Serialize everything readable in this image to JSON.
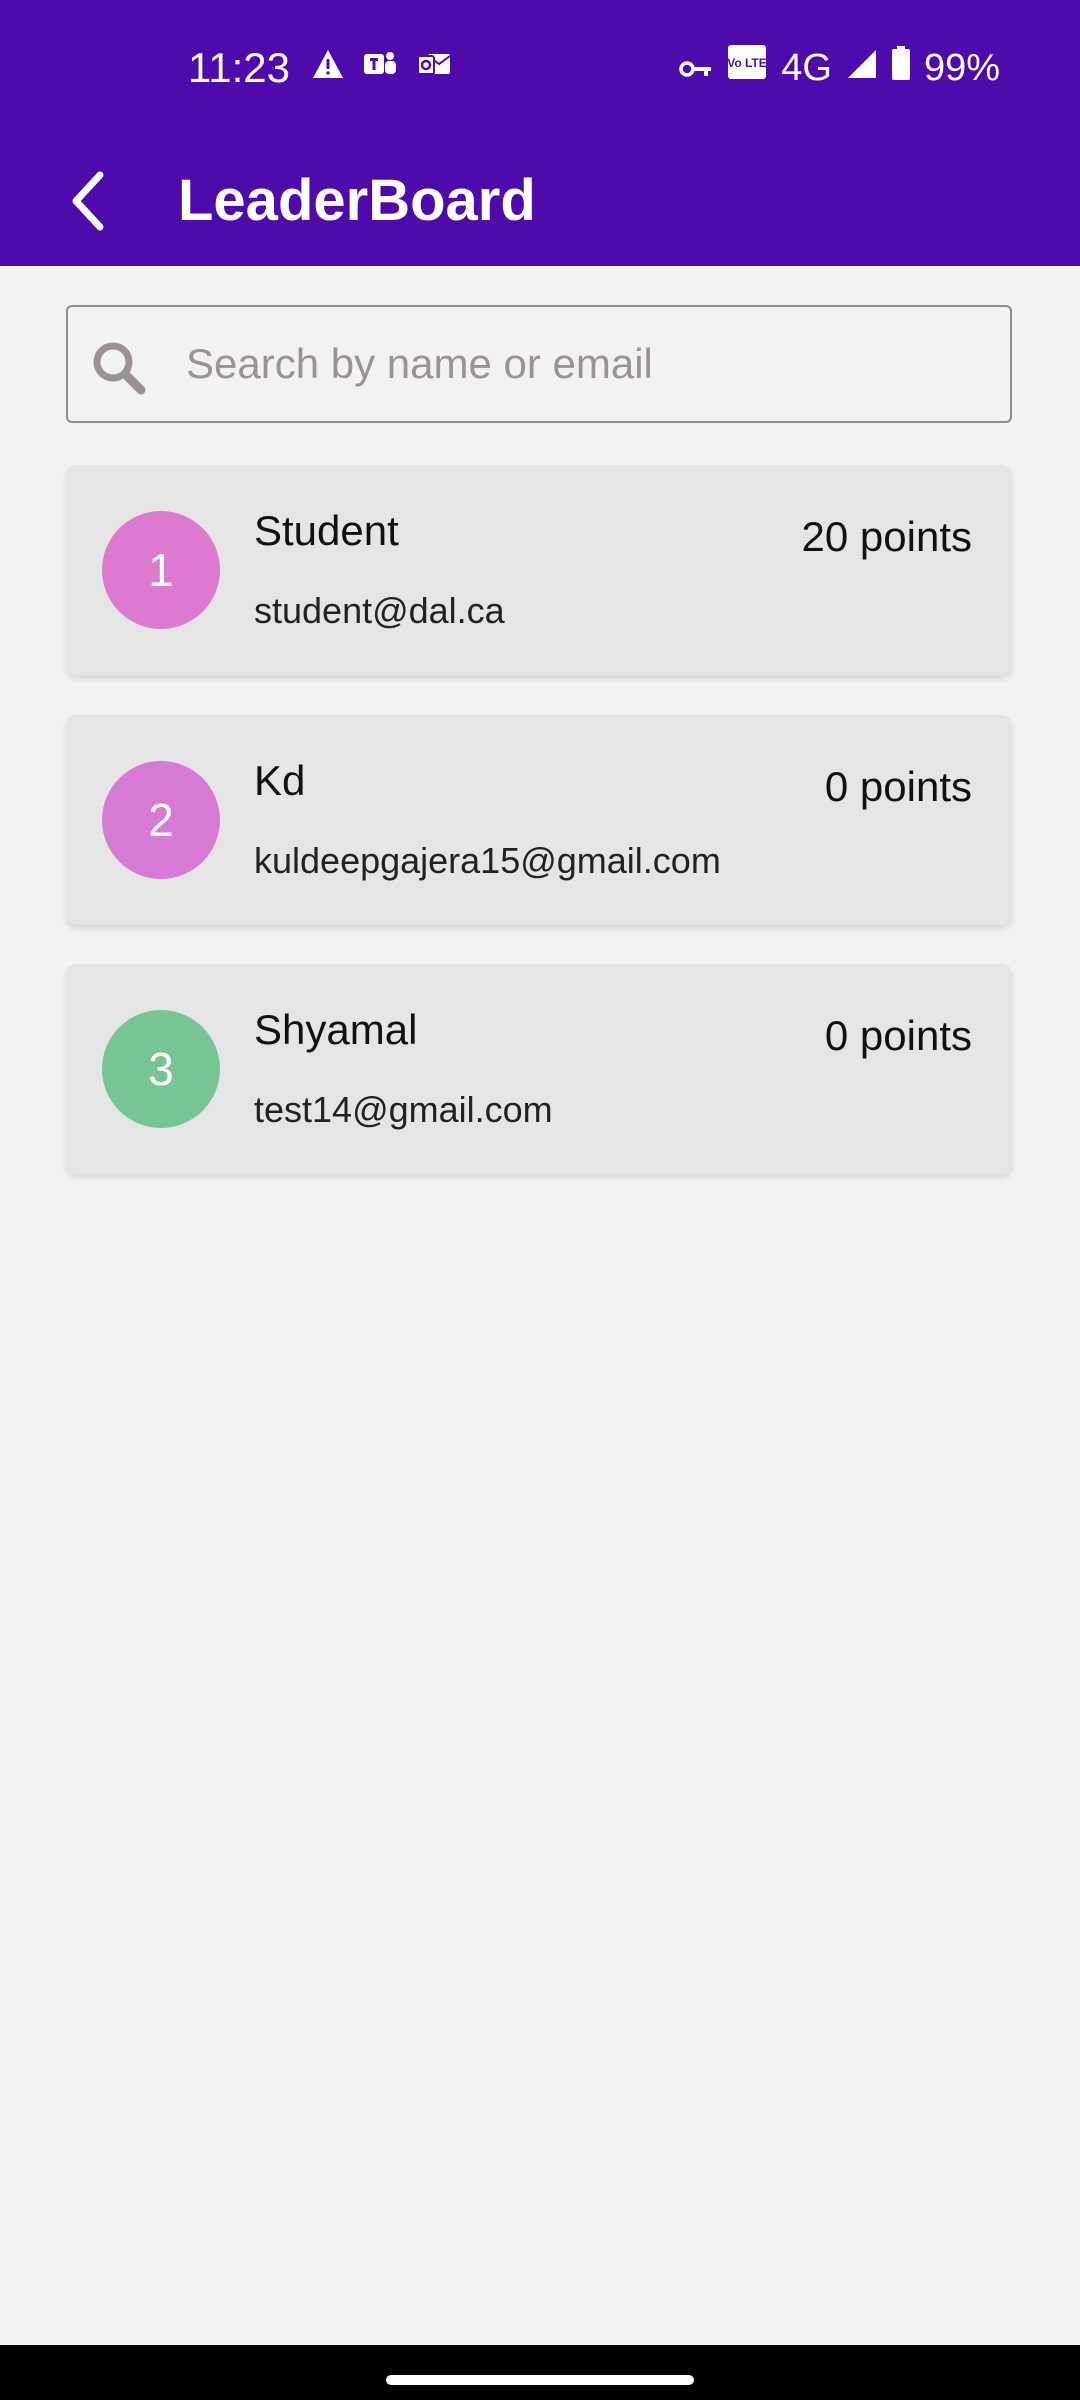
{
  "status_bar": {
    "time": "11:23",
    "network": "4G",
    "battery": "99%",
    "volte_label": "Vo LTE",
    "icons": [
      "alert-icon",
      "teams-icon",
      "outlook-icon",
      "vpn-key-icon",
      "volte-icon",
      "signal-icon",
      "battery-icon"
    ]
  },
  "app_bar": {
    "title": "LeaderBoard",
    "back_icon": "back-arrow-icon",
    "background_color": "#4f0aab"
  },
  "search": {
    "placeholder": "Search by name or email",
    "value": "",
    "icon": "search-icon"
  },
  "leaderboard": [
    {
      "rank": "1",
      "name": "Student",
      "email": "student@dal.ca",
      "points": "20 points",
      "avatar_color": "#dc7ad0"
    },
    {
      "rank": "2",
      "name": "Kd",
      "email": "kuldeepgajera15@gmail.com",
      "points": "0 points",
      "avatar_color": "#d67ad6"
    },
    {
      "rank": "3",
      "name": "Shyamal",
      "email": "test14@gmail.com",
      "points": "0 points",
      "avatar_color": "#77c595"
    }
  ]
}
